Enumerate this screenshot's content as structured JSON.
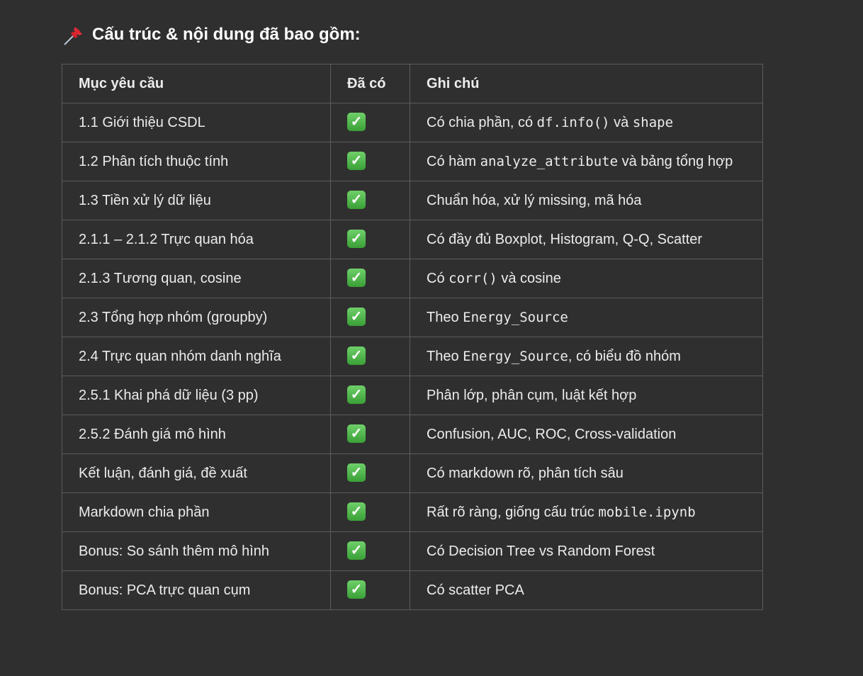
{
  "heading": {
    "icon": "pushpin-icon",
    "text": "Cấu trúc & nội dung đã bao gồm:"
  },
  "table": {
    "headers": [
      "Mục yêu cầu",
      "Đã có",
      "Ghi chú"
    ],
    "rows": [
      {
        "item": "1.1 Giới thiệu CSDL",
        "done": true,
        "note": [
          {
            "t": "Có chia phần, có "
          },
          {
            "t": "df.info()",
            "code": true
          },
          {
            "t": " và "
          },
          {
            "t": "shape",
            "code": true
          }
        ]
      },
      {
        "item": "1.2 Phân tích thuộc tính",
        "done": true,
        "note": [
          {
            "t": "Có hàm "
          },
          {
            "t": "analyze_attribute",
            "code": true
          },
          {
            "t": " và bảng tổng hợp"
          }
        ]
      },
      {
        "item": "1.3 Tiền xử lý dữ liệu",
        "done": true,
        "note": [
          {
            "t": "Chuẩn hóa, xử lý missing, mã hóa"
          }
        ]
      },
      {
        "item": "2.1.1 – 2.1.2 Trực quan hóa",
        "done": true,
        "note": [
          {
            "t": "Có đầy đủ Boxplot, Histogram, Q-Q, Scatter"
          }
        ]
      },
      {
        "item": "2.1.3 Tương quan, cosine",
        "done": true,
        "note": [
          {
            "t": "Có "
          },
          {
            "t": "corr()",
            "code": true
          },
          {
            "t": " và cosine"
          }
        ]
      },
      {
        "item": "2.3 Tổng hợp nhóm (groupby)",
        "done": true,
        "note": [
          {
            "t": "Theo "
          },
          {
            "t": "Energy_Source",
            "code": true
          }
        ]
      },
      {
        "item": "2.4 Trực quan nhóm danh nghĩa",
        "done": true,
        "note": [
          {
            "t": "Theo "
          },
          {
            "t": "Energy_Source",
            "code": true
          },
          {
            "t": ", có biểu đồ nhóm"
          }
        ]
      },
      {
        "item": "2.5.1 Khai phá dữ liệu (3 pp)",
        "done": true,
        "note": [
          {
            "t": "Phân lớp, phân cụm, luật kết hợp"
          }
        ]
      },
      {
        "item": "2.5.2 Đánh giá mô hình",
        "done": true,
        "note": [
          {
            "t": "Confusion, AUC, ROC, Cross-validation"
          }
        ]
      },
      {
        "item": "Kết luận, đánh giá, đề xuất",
        "done": true,
        "note": [
          {
            "t": "Có markdown rõ, phân tích sâu"
          }
        ]
      },
      {
        "item": "Markdown chia phần",
        "done": true,
        "note": [
          {
            "t": "Rất rõ ràng, giống cấu trúc "
          },
          {
            "t": "mobile.ipynb",
            "code": true
          }
        ]
      },
      {
        "item": "Bonus: So sánh thêm mô hình",
        "done": true,
        "note": [
          {
            "t": "Có Decision Tree vs Random Forest"
          }
        ]
      },
      {
        "item": "Bonus: PCA trực quan cụm",
        "done": true,
        "note": [
          {
            "t": "Có scatter PCA"
          }
        ]
      }
    ]
  }
}
